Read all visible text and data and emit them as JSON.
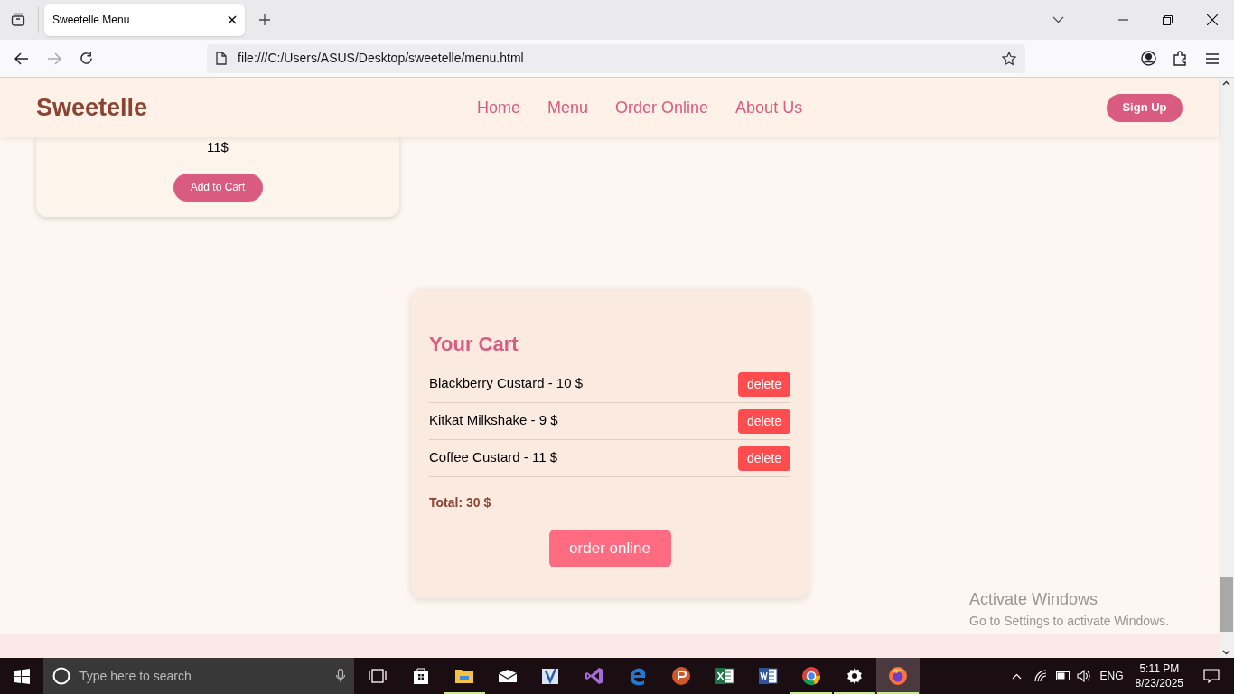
{
  "browser": {
    "tab_title": "Sweetelle Menu",
    "url": "file:///C:/Users/ASUS/Desktop/sweetelle/menu.html"
  },
  "navbar": {
    "logo": "Sweetelle",
    "links": [
      {
        "label": "Home"
      },
      {
        "label": "Menu"
      },
      {
        "label": "Order Online"
      },
      {
        "label": "About Us"
      }
    ],
    "signup": "Sign Up"
  },
  "product_card": {
    "price": "11$",
    "button": "Add to Cart"
  },
  "cart": {
    "title": "Your Cart",
    "items": [
      {
        "text": "Blackberry Custard - 10 $",
        "button": "delete"
      },
      {
        "text": "Kitkat Milkshake - 9 $",
        "button": "delete"
      },
      {
        "text": "Coffee Custard - 11 $",
        "button": "delete"
      }
    ],
    "total": "Total: 30 $",
    "order_button": "order online"
  },
  "activation": {
    "title": "Activate Windows",
    "subtitle": "Go to Settings to activate Windows."
  },
  "taskbar": {
    "search_placeholder": "Type here to search",
    "apps": [
      {
        "running": false,
        "active": false
      },
      {
        "running": false,
        "active": false
      },
      {
        "running": true,
        "active": false
      },
      {
        "running": false,
        "active": false
      },
      {
        "running": false,
        "active": false
      },
      {
        "running": false,
        "active": false
      },
      {
        "running": false,
        "active": false
      },
      {
        "running": false,
        "active": false
      },
      {
        "running": false,
        "active": false
      },
      {
        "running": false,
        "active": false
      },
      {
        "running": true,
        "active": false
      },
      {
        "running": true,
        "active": false
      },
      {
        "running": true,
        "active": true
      }
    ],
    "language": "ENG",
    "time": "5:11 PM",
    "date": "8/23/2025"
  }
}
